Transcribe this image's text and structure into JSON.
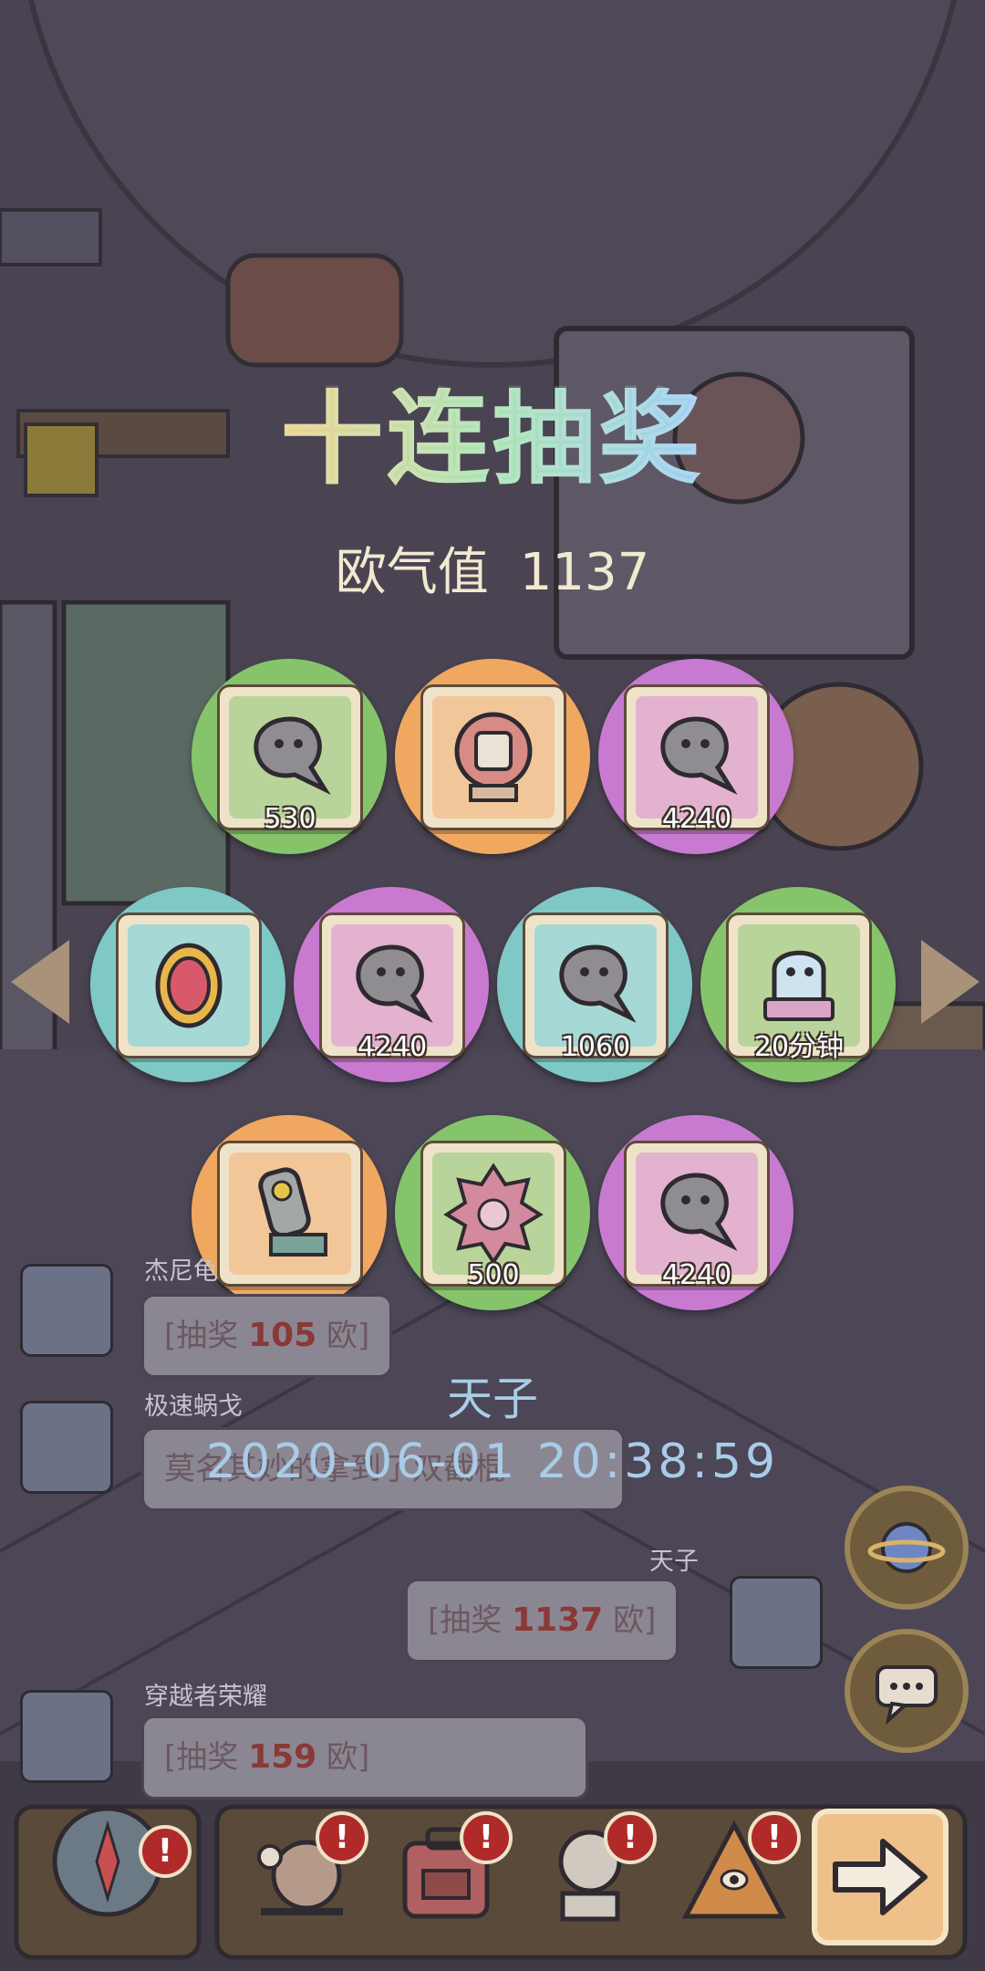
{
  "title": "十连抽奖",
  "luck": {
    "label": "欧气值",
    "value": "1137"
  },
  "rewards": [
    {
      "icon": "ghost-soul-icon",
      "qty": "530",
      "color": "#86c46c"
    },
    {
      "icon": "crystal-ball-icon",
      "qty": "",
      "color": "#f0a860"
    },
    {
      "icon": "ghost-soul-icon",
      "qty": "4240",
      "color": "#c77ad0"
    },
    {
      "icon": "gem-amulet-icon",
      "qty": "",
      "color": "#7ec8c6"
    },
    {
      "icon": "ghost-soul-icon",
      "qty": "4240",
      "color": "#c77ad0"
    },
    {
      "icon": "ghost-soul-icon",
      "qty": "1060",
      "color": "#7ec8c6"
    },
    {
      "icon": "ghost-timer-icon",
      "qty": "20分钟",
      "color": "#86c46c"
    },
    {
      "icon": "nuclear-canister-icon",
      "qty": "",
      "color": "#f0a860"
    },
    {
      "icon": "spiked-shell-icon",
      "qty": "500",
      "color": "#86c46c"
    },
    {
      "icon": "ghost-soul-icon",
      "qty": "4240",
      "color": "#c77ad0"
    }
  ],
  "chat": {
    "messages": [
      {
        "name": "杰尼龟",
        "prefix": "[抽奖 ",
        "amount": "105",
        "suffix": " 欧]"
      },
      {
        "name": "极速蜗戈",
        "text": "莫名其妙的拿到了双截棍"
      },
      {
        "name": "天子",
        "prefix": "[抽奖 ",
        "amount": "1137",
        "suffix": " 欧]"
      },
      {
        "name": "穿越者荣耀",
        "prefix": "[抽奖 ",
        "amount": "159",
        "suffix": " 欧]"
      }
    ]
  },
  "overlay": {
    "name": "天子",
    "timestamp": "2020-06-01 20:38:59"
  },
  "icons": {
    "prev": "arrow-left-icon",
    "next": "arrow-right-icon",
    "planet": "planet-icon",
    "chat_bubble": "chat-bubble-icon",
    "compass": "compass-icon",
    "snail": "snail-icon",
    "backpack": "backpack-icon",
    "statue": "statue-icon",
    "pyramid": "pyramid-eye-icon",
    "exit": "arrow-exit-icon",
    "badge": "!"
  },
  "colors": {
    "green": "#86c46c",
    "orange": "#f0a860",
    "purple": "#c77ad0",
    "teal": "#7ec8c6",
    "overlay_text": "#a9cce8",
    "badge": "#b02a2a"
  }
}
